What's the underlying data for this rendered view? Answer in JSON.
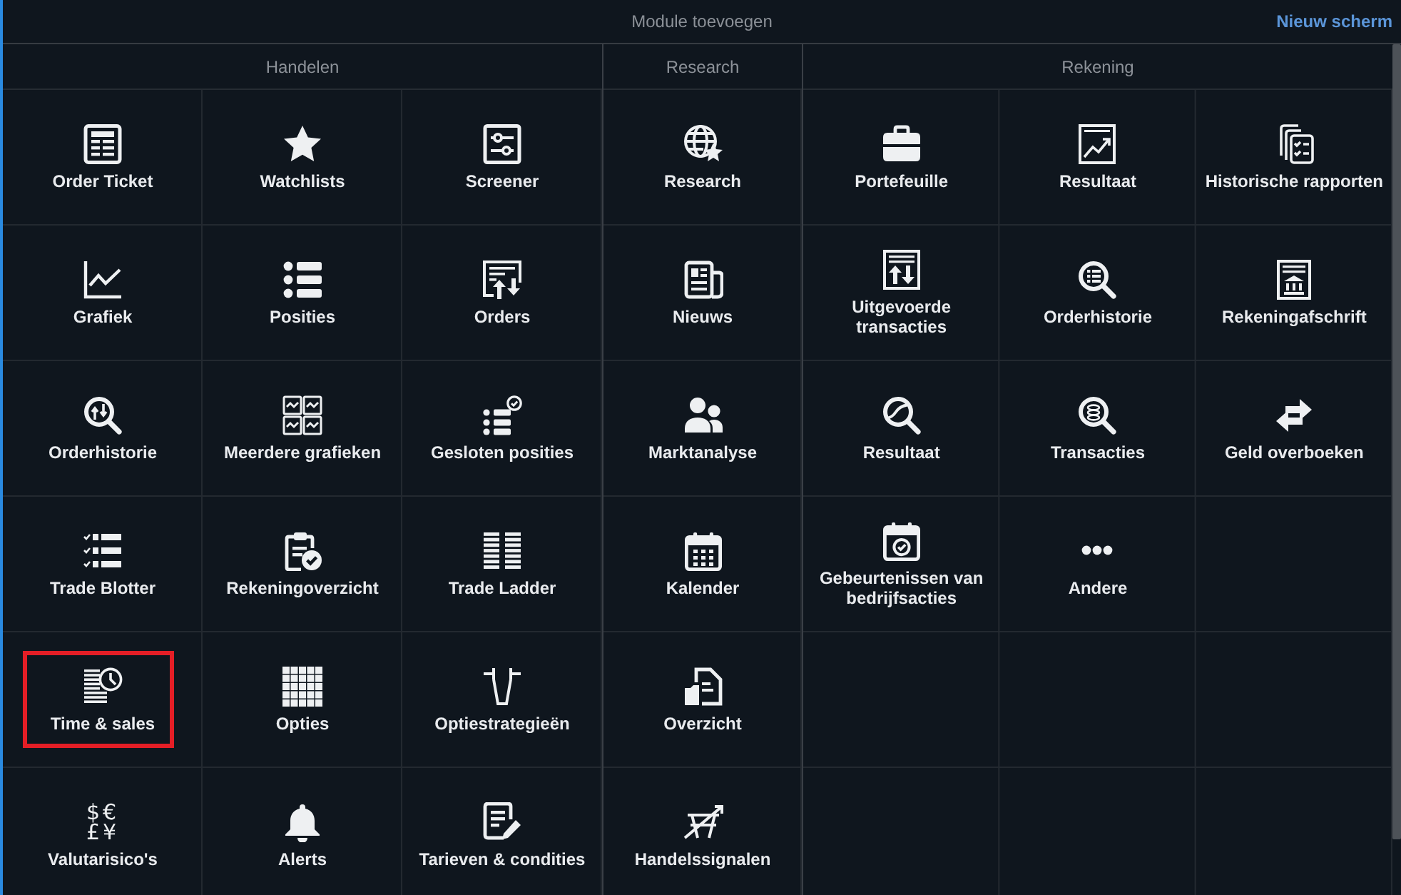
{
  "window": {
    "title": "Module toevoegen",
    "action": "Nieuw scherm"
  },
  "sections": [
    {
      "title": "Handelen",
      "items": [
        {
          "label": "Order Ticket",
          "highlighted": false
        },
        {
          "label": "Watchlists",
          "highlighted": false
        },
        {
          "label": "Screener",
          "highlighted": false
        },
        {
          "label": "Grafiek",
          "highlighted": false
        },
        {
          "label": "Posities",
          "highlighted": false
        },
        {
          "label": "Orders",
          "highlighted": false
        },
        {
          "label": "Orderhistorie",
          "highlighted": false
        },
        {
          "label": "Meerdere grafieken",
          "highlighted": false
        },
        {
          "label": "Gesloten posities",
          "highlighted": false
        },
        {
          "label": "Trade Blotter",
          "highlighted": false
        },
        {
          "label": "Rekeningoverzicht",
          "highlighted": false
        },
        {
          "label": "Trade Ladder",
          "highlighted": false
        },
        {
          "label": "Time & sales",
          "highlighted": true
        },
        {
          "label": "Opties",
          "highlighted": false
        },
        {
          "label": "Optiestrategieën",
          "highlighted": false
        },
        {
          "label": "Valutarisico's",
          "symbols": "$€ £¥",
          "highlighted": false
        },
        {
          "label": "Alerts",
          "highlighted": false
        },
        {
          "label": "Tarieven & condities",
          "highlighted": false
        }
      ]
    },
    {
      "title": "Research",
      "items": [
        {
          "label": "Research",
          "highlighted": false
        },
        {
          "label": "Nieuws",
          "highlighted": false
        },
        {
          "label": "Marktanalyse",
          "highlighted": false
        },
        {
          "label": "Kalender",
          "highlighted": false
        },
        {
          "label": "Overzicht",
          "highlighted": false
        },
        {
          "label": "Handelssignalen",
          "highlighted": false
        }
      ]
    },
    {
      "title": "Rekening",
      "items": [
        {
          "label": "Portefeuille",
          "highlighted": false
        },
        {
          "label": "Resultaat",
          "highlighted": false
        },
        {
          "label": "Historische rapporten",
          "highlighted": false
        },
        {
          "label": "Uitgevoerde transacties",
          "highlighted": false
        },
        {
          "label": "Orderhistorie",
          "highlighted": false
        },
        {
          "label": "Rekeningafschrift",
          "highlighted": false
        },
        {
          "label": "Resultaat",
          "highlighted": false
        },
        {
          "label": "Transacties",
          "highlighted": false
        },
        {
          "label": "Geld overboeken",
          "highlighted": false
        },
        {
          "label": "Gebeurtenissen van bedrijfsacties",
          "highlighted": false
        },
        {
          "label": "Andere",
          "highlighted": false
        }
      ]
    }
  ]
}
